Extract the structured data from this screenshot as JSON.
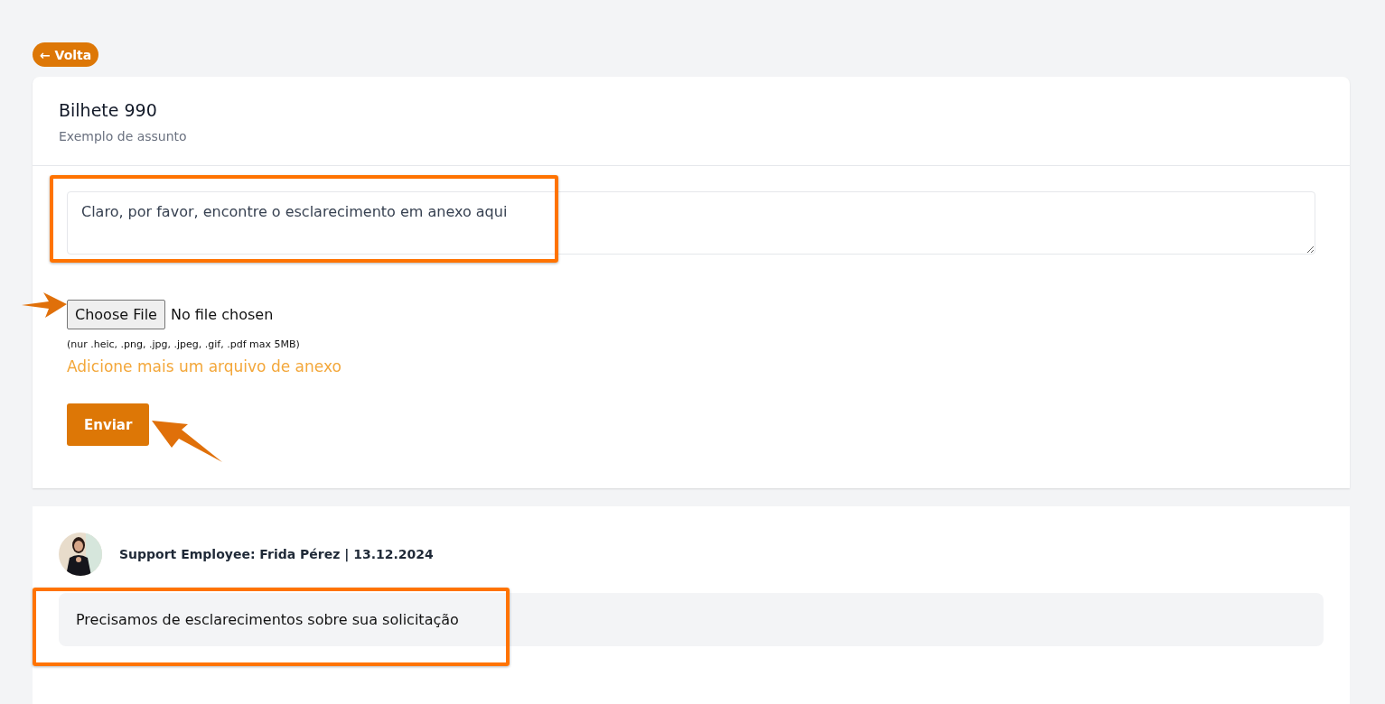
{
  "back_button": {
    "label": "← Volta"
  },
  "ticket": {
    "title": "Bilhete 990",
    "subject": "Exemplo de assunto"
  },
  "reply_form": {
    "message": {
      "value": "Claro, por favor, encontre o esclarecimento em anexo aqui"
    },
    "file_input": {
      "button": "Choose File",
      "status": "No file chosen"
    },
    "file_hint": "(nur .heic, .png, .jpg, .jpeg, .gif, .pdf max 5MB)",
    "add_attachment_link": "Adicione mais um arquivo de anexo",
    "submit_button": "Enviar"
  },
  "messages": [
    {
      "author_line": "Support Employee: Frida Pérez | 13.12.2024",
      "text": "Precisamos de esclarecimentos sobre sua solicitação"
    }
  ]
}
